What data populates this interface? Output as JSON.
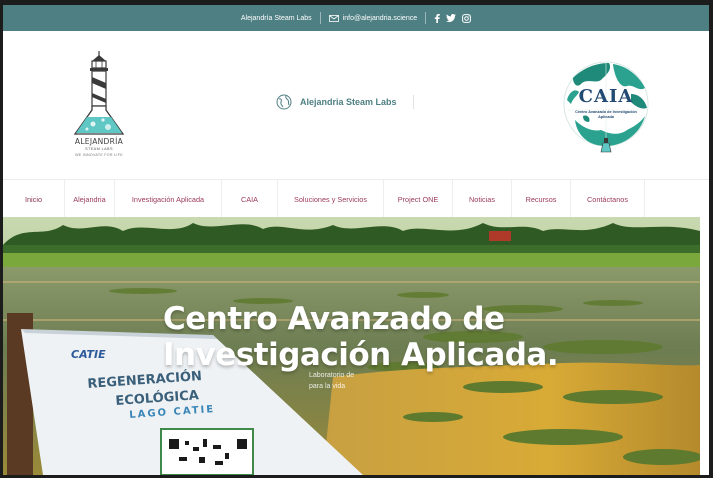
{
  "topbar": {
    "site_name": "Alejandría Steam Labs",
    "email": "info@alejandria.science",
    "social_icons": [
      "facebook-icon",
      "twitter-icon",
      "instagram-icon"
    ]
  },
  "header": {
    "logo_name": "ALEJANDRÍA",
    "logo_sub": "STEAM LABS",
    "logo_tagline": "WE INNOVATE FOR LIFE",
    "center_brand": "Alejandria Steam Labs",
    "caia_title": "CAIA",
    "caia_subtitle": "Centro Avanzado de Investigación Aplicada"
  },
  "nav": {
    "items": [
      {
        "label": "Inicio",
        "active": true
      },
      {
        "label": "Alejandria"
      },
      {
        "label": "Investigación Aplicada"
      },
      {
        "label": "CAIA"
      },
      {
        "label": "Soluciones y Servicios"
      },
      {
        "label": "Project ONE"
      },
      {
        "label": "Noticias"
      },
      {
        "label": "Recursos"
      },
      {
        "label": "Contáctanos"
      }
    ]
  },
  "hero": {
    "title_line1": "Centro Avanzado de",
    "title_line2": "Investigación Aplicada.",
    "sub_line1": "Laboratorio de",
    "sub_line2": "para la vida",
    "sign_brand": "CATIE",
    "sign_line1": "REGENERACIÓN",
    "sign_line2": "ECOLÓGICA",
    "sign_line3": "LAGO CATIE"
  },
  "colors": {
    "brand_teal": "#4e7f82",
    "nav_text": "#9b3a5a"
  }
}
